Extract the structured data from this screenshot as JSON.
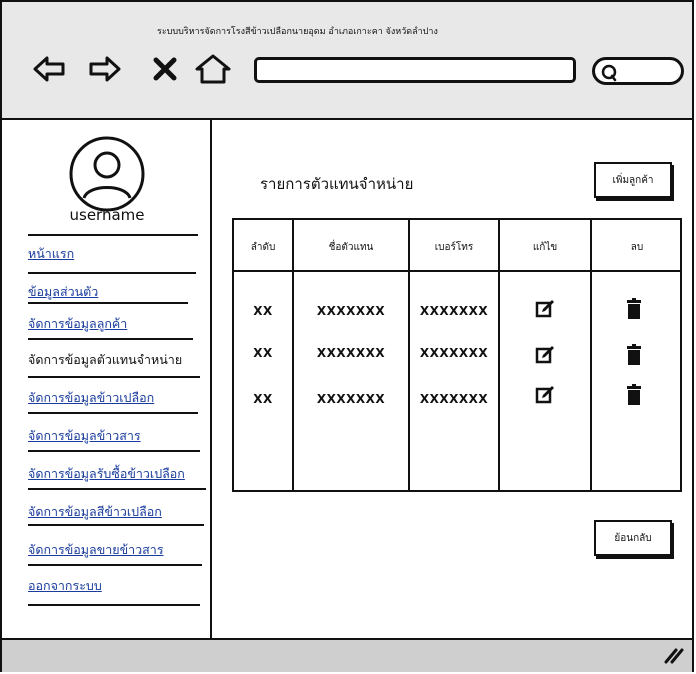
{
  "window": {
    "title": "ระบบบริหารจัดการโรงสีข้าวเปลือกนายอุดม อำเภอเกาะคา จังหวัดลำปาง"
  },
  "toolbar": {
    "icons": [
      "back-arrow-icon",
      "forward-arrow-icon",
      "close-icon",
      "home-icon",
      "search-icon"
    ],
    "url_value": "",
    "search_value": ""
  },
  "sidebar": {
    "username": "username",
    "items": [
      {
        "label": "หน้าแรก",
        "active": false
      },
      {
        "label": "ข้อมูลส่วนตัว",
        "active": false
      },
      {
        "label": "จัดการข้อมูลลูกค้า",
        "active": false
      },
      {
        "label": "จัดการข้อมูลตัวแทนจำหน่าย",
        "active": true
      },
      {
        "label": "จัดการข้อมูลข้าวเปลือก",
        "active": false
      },
      {
        "label": "จัดการข้อมูลข้าวสาร",
        "active": false
      },
      {
        "label": "จัดการข้อมูลรับซื้อข้าวเปลือก",
        "active": false
      },
      {
        "label": "จัดการข้อมูลสีข้าวเปลือก",
        "active": false
      },
      {
        "label": "จัดการข้อมูลขายข้าวสาร",
        "active": false
      },
      {
        "label": "ออกจากระบบ",
        "active": false
      }
    ]
  },
  "main": {
    "title": "รายการตัวแทนจำหน่าย",
    "add_button": "เพิ่มลูกค้า",
    "back_button": "ย้อนกลับ",
    "table": {
      "headers": [
        "ลำดับ",
        "ชื่อตัวแทน",
        "เบอร์โทร",
        "แก้ไข",
        "ลบ"
      ],
      "rows": [
        {
          "no": "XX",
          "name": "XXXXXXX",
          "phone": "XXXXXXX"
        },
        {
          "no": "XX",
          "name": "XXXXXXX",
          "phone": "XXXXXXX"
        },
        {
          "no": "XX",
          "name": "XXXXXXX",
          "phone": "XXXXXXX"
        }
      ],
      "row_icons": {
        "edit": "edit-icon",
        "delete": "trash-icon"
      }
    }
  }
}
